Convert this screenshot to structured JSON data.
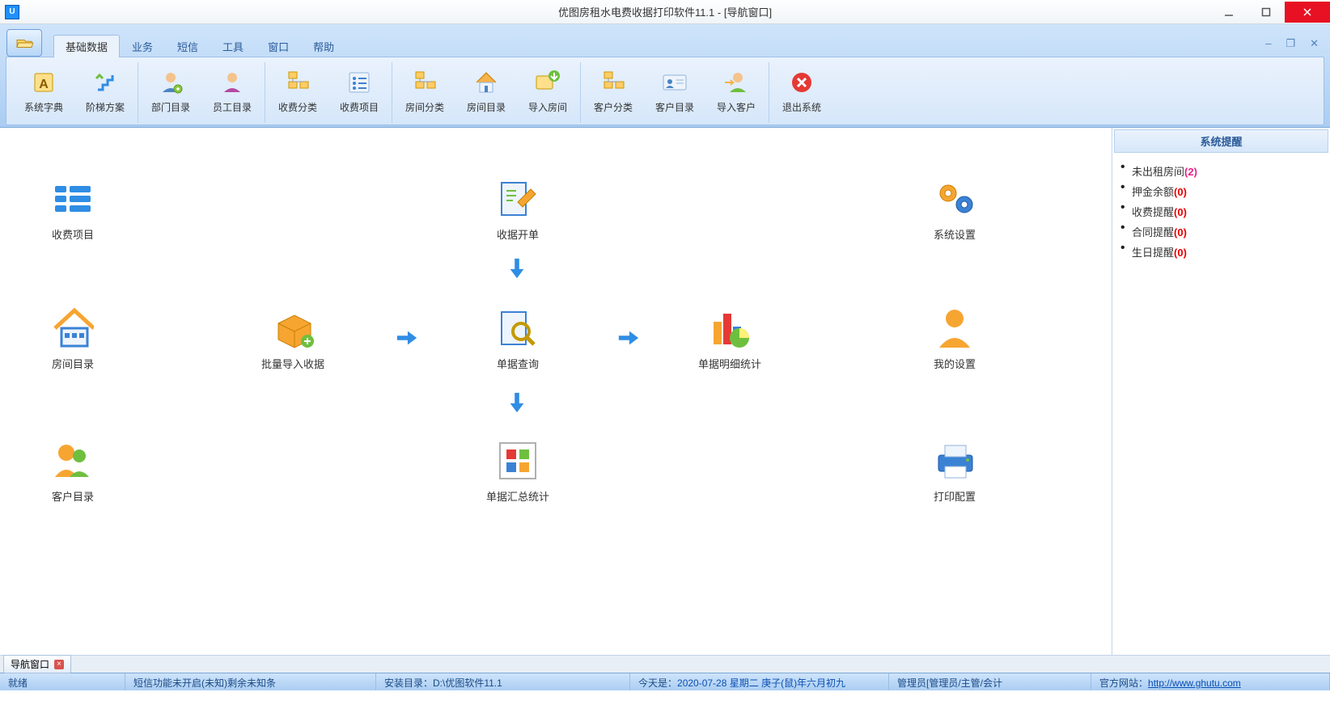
{
  "window": {
    "title": "优图房租水电费收据打印软件11.1 - [导航窗口]",
    "app_icon_text": "U"
  },
  "ribbon_tabs": [
    "基础数据",
    "业务",
    "短信",
    "工具",
    "窗口",
    "帮助"
  ],
  "ribbon": {
    "g1": {
      "sys_dict": "系统字典",
      "ladder": "阶梯方案"
    },
    "g2": {
      "dept": "部门目录",
      "emp": "员工目录"
    },
    "g3": {
      "fee_cat": "收费分类",
      "fee_item": "收费项目"
    },
    "g4": {
      "room_cat": "房间分类",
      "room_dir": "房间目录",
      "imp_room": "导入房间"
    },
    "g5": {
      "cust_cat": "客户分类",
      "cust_dir": "客户目录",
      "imp_cust": "导入客户"
    },
    "g6": {
      "exit": "退出系统"
    }
  },
  "nav": {
    "fee_item": "收费项目",
    "room_dir": "房间目录",
    "cust_dir": "客户目录",
    "receipt_open": "收据开单",
    "batch_import": "批量导入收据",
    "bill_query": "单据查询",
    "bill_detail": "单据明细统计",
    "bill_summary": "单据汇总统计",
    "sys_setting": "系统设置",
    "my_setting": "我的设置",
    "print_conf": "打印配置"
  },
  "reminder": {
    "title": "系统提醒",
    "unrented_label": "未出租房间",
    "unrented_count": "(2)",
    "deposit_label": "押金余额",
    "deposit_count": "(0)",
    "fee_label": "收费提醒",
    "fee_count": "(0)",
    "contract_label": "合同提醒",
    "contract_count": "(0)",
    "birthday_label": "生日提醒",
    "birthday_count": "(0)"
  },
  "doc_tab": "导航窗口",
  "status": {
    "ready": "就绪",
    "sms": "短信功能未开启(未知)剩余未知条",
    "install": "安装目录：D:\\优图软件11.1",
    "today_label": "今天是：",
    "today_value": "2020-07-28 星期二 庚子(鼠)年六月初九",
    "admin": "管理员[管理员/主管/会计",
    "site_label": "官方网站：",
    "site_url": "http://www.ghutu.com"
  }
}
